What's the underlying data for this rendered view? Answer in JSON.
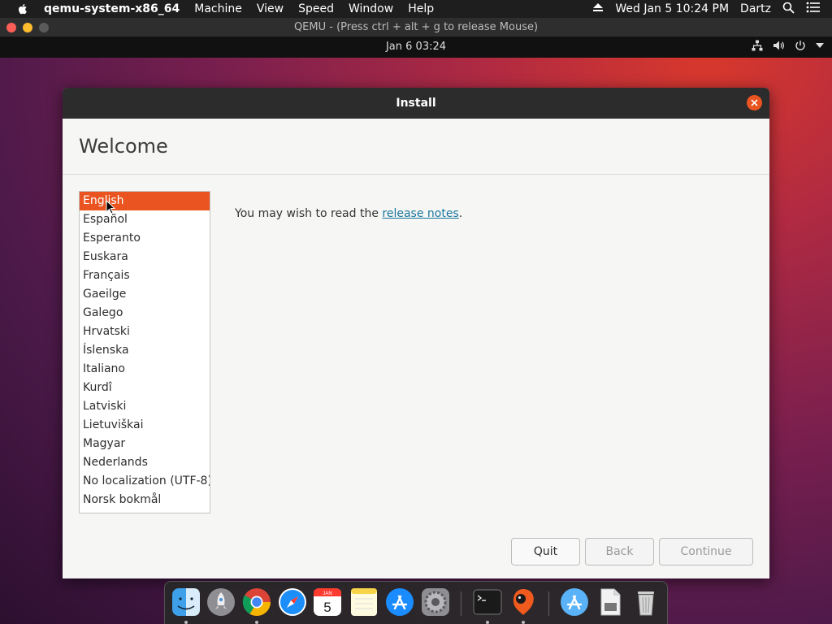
{
  "menubar": {
    "app_name": "qemu-system-x86_64",
    "items": [
      "Machine",
      "View",
      "Speed",
      "Window",
      "Help"
    ],
    "datetime": "Wed Jan 5  10:24 PM",
    "user": "Dartz"
  },
  "qemu_window": {
    "title": "QEMU - (Press ctrl + alt + g to release Mouse)"
  },
  "guest_panel": {
    "clock": "Jan 6  03:24"
  },
  "installer": {
    "title": "Install",
    "heading": "Welcome",
    "languages": [
      "English",
      "Español",
      "Esperanto",
      "Euskara",
      "Français",
      "Gaeilge",
      "Galego",
      "Hrvatski",
      "Íslenska",
      "Italiano",
      "Kurdî",
      "Latviski",
      "Lietuviškai",
      "Magyar",
      "Nederlands",
      "No localization (UTF-8)",
      "Norsk bokmål"
    ],
    "selected_language": "English",
    "notes_prefix": "You may wish to read the ",
    "notes_link": "release notes",
    "notes_suffix": ".",
    "buttons": {
      "quit": "Quit",
      "back": "Back",
      "continue": "Continue"
    }
  },
  "dock": {
    "apps": [
      {
        "name": "finder-icon",
        "running": true
      },
      {
        "name": "launchpad-icon",
        "running": false
      },
      {
        "name": "chrome-icon",
        "running": true
      },
      {
        "name": "safari-icon",
        "running": false
      },
      {
        "name": "calendar-icon",
        "running": false,
        "label": "JAN",
        "day": "5"
      },
      {
        "name": "notes-icon",
        "running": false
      },
      {
        "name": "app-store-icon",
        "running": false
      },
      {
        "name": "system-preferences-icon",
        "running": false
      },
      {
        "name": "terminal-icon",
        "running": true
      },
      {
        "name": "qemu-icon",
        "running": true
      },
      {
        "name": "applications-folder-icon",
        "running": false
      },
      {
        "name": "document-icon",
        "running": false
      },
      {
        "name": "trash-icon",
        "running": false
      }
    ]
  },
  "colors": {
    "accent": "#e95420",
    "link": "#19769c"
  }
}
